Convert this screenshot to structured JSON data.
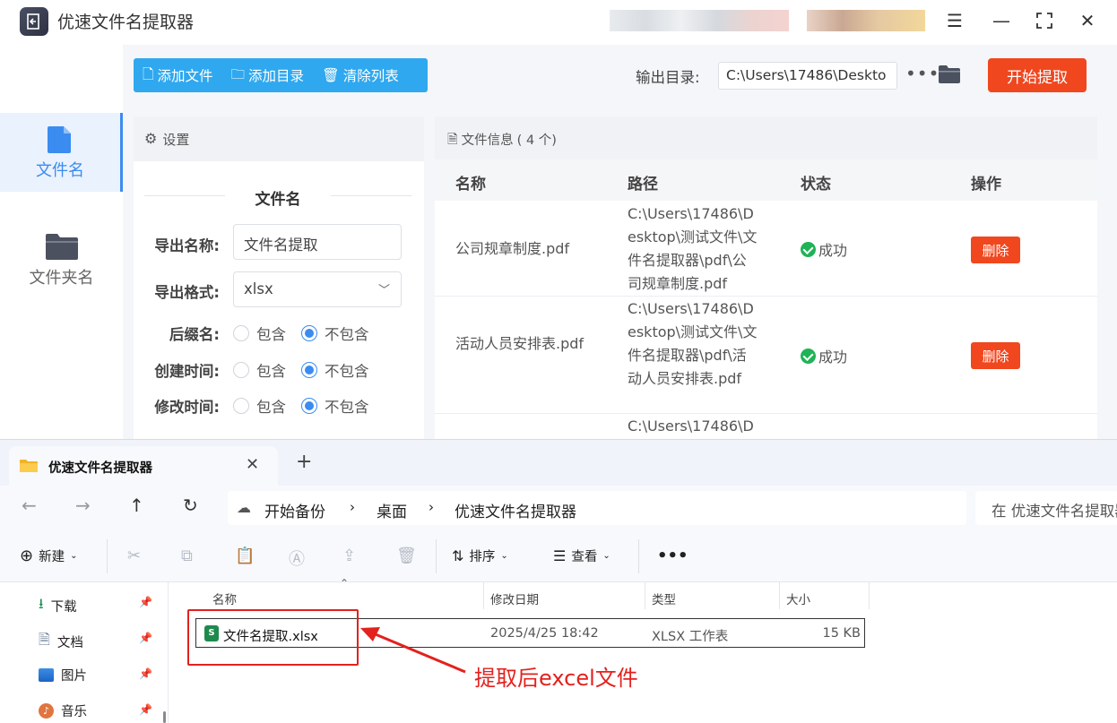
{
  "app": {
    "title": "优速文件名提取器",
    "window_controls": [
      "menu-icon",
      "minimize-icon",
      "maximize-icon",
      "close-icon"
    ],
    "sidebar": {
      "items": [
        {
          "label": "文件名",
          "icon": "file-icon",
          "active": true
        },
        {
          "label": "文件夹名",
          "icon": "folder-icon",
          "active": false
        }
      ]
    },
    "toolbar": {
      "add_file": "添加文件",
      "add_dir": "添加目录",
      "clear_list": "清除列表"
    },
    "output": {
      "label": "输出目录:",
      "path": "C:\\Users\\17486\\Deskto",
      "more": "•••"
    },
    "start_button": "开始提取",
    "settings": {
      "title": "设置",
      "section_title": "文件名",
      "export_name_label": "导出名称:",
      "export_name_value": "文件名提取",
      "export_format_label": "导出格式:",
      "export_format_value": "xlsx",
      "options": [
        {
          "label": "后缀名:",
          "include": "包含",
          "exclude": "不包含",
          "selected": "exclude"
        },
        {
          "label": "创建时间:",
          "include": "包含",
          "exclude": "不包含",
          "selected": "exclude"
        },
        {
          "label": "修改时间:",
          "include": "包含",
          "exclude": "不包含",
          "selected": "exclude"
        }
      ]
    },
    "file_info": {
      "title": "文件信息",
      "count": "( 4 个)",
      "columns": [
        "名称",
        "路径",
        "状态",
        "操作"
      ],
      "rows": [
        {
          "name": "公司规章制度.pdf",
          "path": "C:\\Users\\17486\\Desktop\\测试文件\\文件名提取器\\pdf\\公司规章制度.pdf",
          "status": "成功",
          "action": "删除"
        },
        {
          "name": "活动人员安排表.pdf",
          "path": "C:\\Users\\17486\\Desktop\\测试文件\\文件名提取器\\pdf\\活动人员安排表.pdf",
          "status": "成功",
          "action": "删除"
        },
        {
          "name": "",
          "path": "C:\\Users\\17486\\D",
          "status": "",
          "action": ""
        }
      ]
    }
  },
  "explorer": {
    "tab_title": "优速文件名提取器",
    "breadcrumbs": [
      "开始备份",
      "桌面",
      "优速文件名提取器"
    ],
    "search_placeholder": "在 优速文件名提取器",
    "commands": {
      "new": "新建",
      "sort": "排序",
      "view": "查看",
      "more": "•••"
    },
    "quick_access": [
      {
        "label": "下载",
        "icon": "download-icon"
      },
      {
        "label": "文档",
        "icon": "document-icon"
      },
      {
        "label": "图片",
        "icon": "picture-icon"
      },
      {
        "label": "音乐",
        "icon": "music-icon"
      }
    ],
    "columns": [
      "名称",
      "修改日期",
      "类型",
      "大小"
    ],
    "file": {
      "name": "文件名提取.xlsx",
      "modified": "2025/4/25 18:42",
      "type": "XLSX 工作表",
      "size": "15 KB"
    }
  },
  "annotation": {
    "text": "提取后excel文件",
    "color": "#e3211d"
  },
  "colors": {
    "accent_blue": "#2fa8ef",
    "start_red": "#f0471f",
    "success_green": "#1fb356"
  }
}
